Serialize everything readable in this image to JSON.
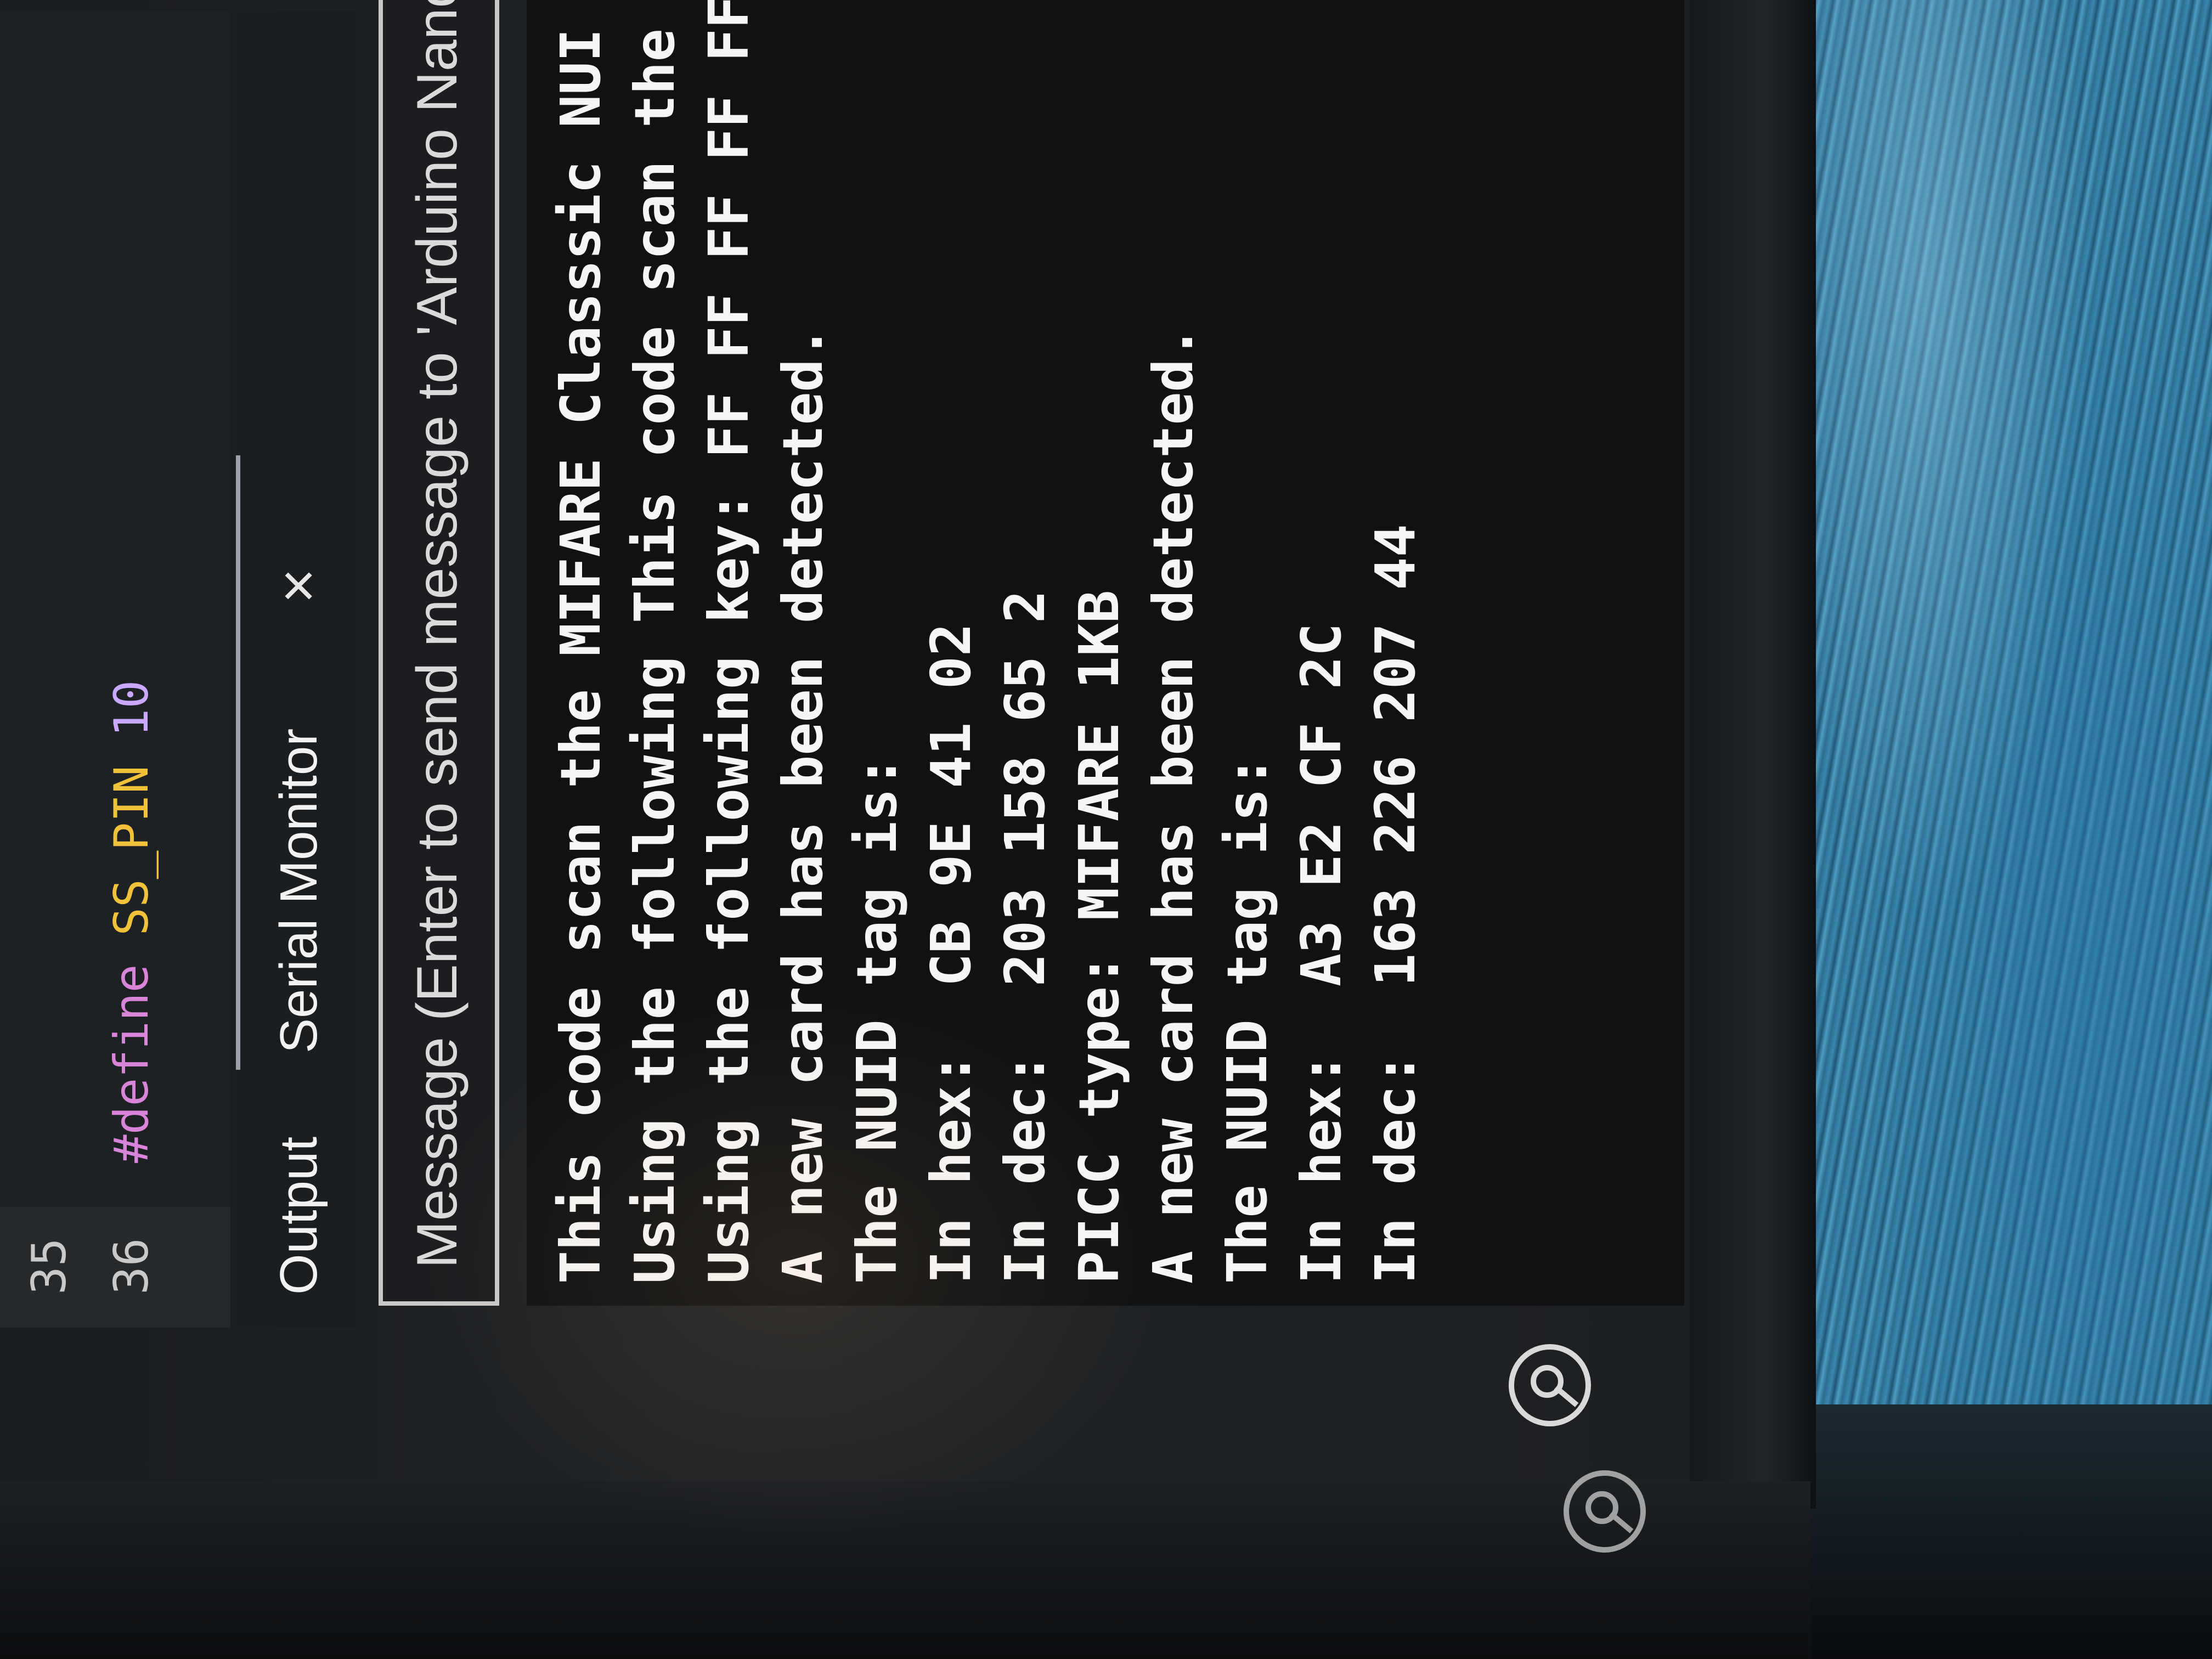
{
  "editor": {
    "lines": [
      {
        "number": "35",
        "keyword": "",
        "identifier": "",
        "value": ""
      },
      {
        "number": "36",
        "keyword": "#define",
        "identifier": "SS_PIN",
        "value": "10"
      }
    ]
  },
  "panel": {
    "tabs": [
      {
        "label": "Output"
      },
      {
        "label": "Serial Monitor"
      }
    ],
    "close_symbol": "×"
  },
  "serial": {
    "message_placeholder": "Message (Enter to send message to 'Arduino Nano",
    "output_lines": [
      "This code scan the MIFARE Classsic NUI",
      "Using the following This code scan the",
      "Using the following key: FF FF FF FF FF",
      "A new card has been detected.",
      "The NUID tag is:",
      "In hex:  CB 9E 41 02",
      "In dec:  203 158 65 2",
      "PICC type: MIFARE 1KB",
      "A new card has been detected.",
      "The NUID tag is:",
      "In hex:  A3 E2 CF 2C",
      "In dec:  163 226 207 44"
    ]
  },
  "icons": {
    "autoscroll": "autoscroll-icon"
  },
  "colors": {
    "keyword": "#d884d8",
    "identifier": "#f0c23a",
    "number": "#c9a9ff",
    "console_bg": "#0f1113",
    "text": "#f5f5f5"
  }
}
